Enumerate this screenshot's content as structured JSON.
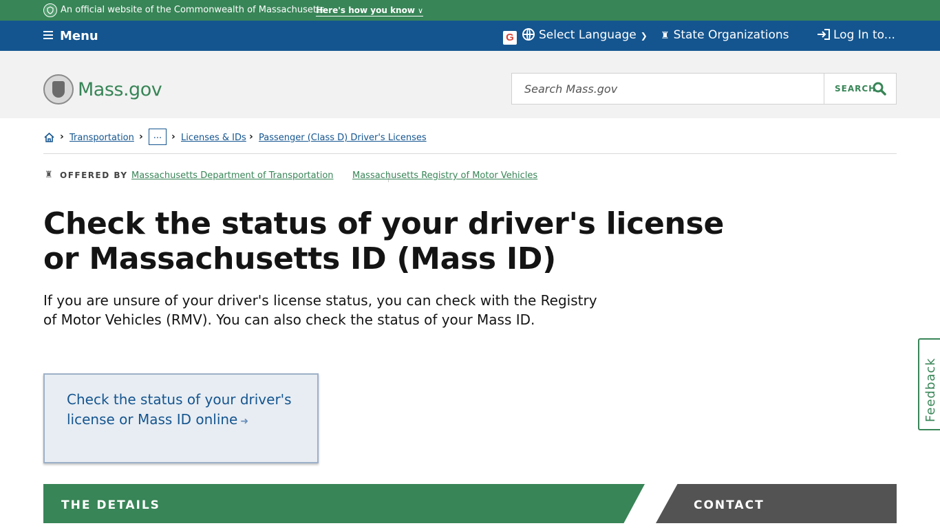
{
  "official_banner": {
    "text": "An official website of the Commonwealth of Massachusetts",
    "toggle_label": "Here's how you know"
  },
  "utility_nav": {
    "menu_label": "Menu",
    "language_label": "Select Language",
    "orgs_label": "State Organizations",
    "login_label": "Log In to..."
  },
  "header": {
    "logo_text": "Mass.gov",
    "search_placeholder": "Search Mass.gov",
    "search_button": "SEARCH"
  },
  "breadcrumb": {
    "items": [
      "Transportation",
      "...",
      "Licenses & IDs",
      "Passenger (Class D) Driver's Licenses"
    ]
  },
  "offered_by": {
    "label": "OFFERED BY",
    "orgs": [
      "Massachusetts Department of Transportation",
      "Massachusetts Registry of Motor Vehicles"
    ]
  },
  "page": {
    "title": "Check the status of your driver's license or Massachusetts ID (Mass ID)",
    "lede": "If you are unsure of your driver's license status, you can check with the Registry of Motor Vehicles (RMV). You can also check the status of your Mass ID.",
    "callout_link": "Check the status of your driver's license or Mass ID online"
  },
  "tabs": {
    "details": "THE DETAILS",
    "contact": "CONTACT"
  },
  "feedback_label": "Feedback",
  "colors": {
    "green": "#388557",
    "blue": "#14558f",
    "gray_tab": "#535353"
  }
}
